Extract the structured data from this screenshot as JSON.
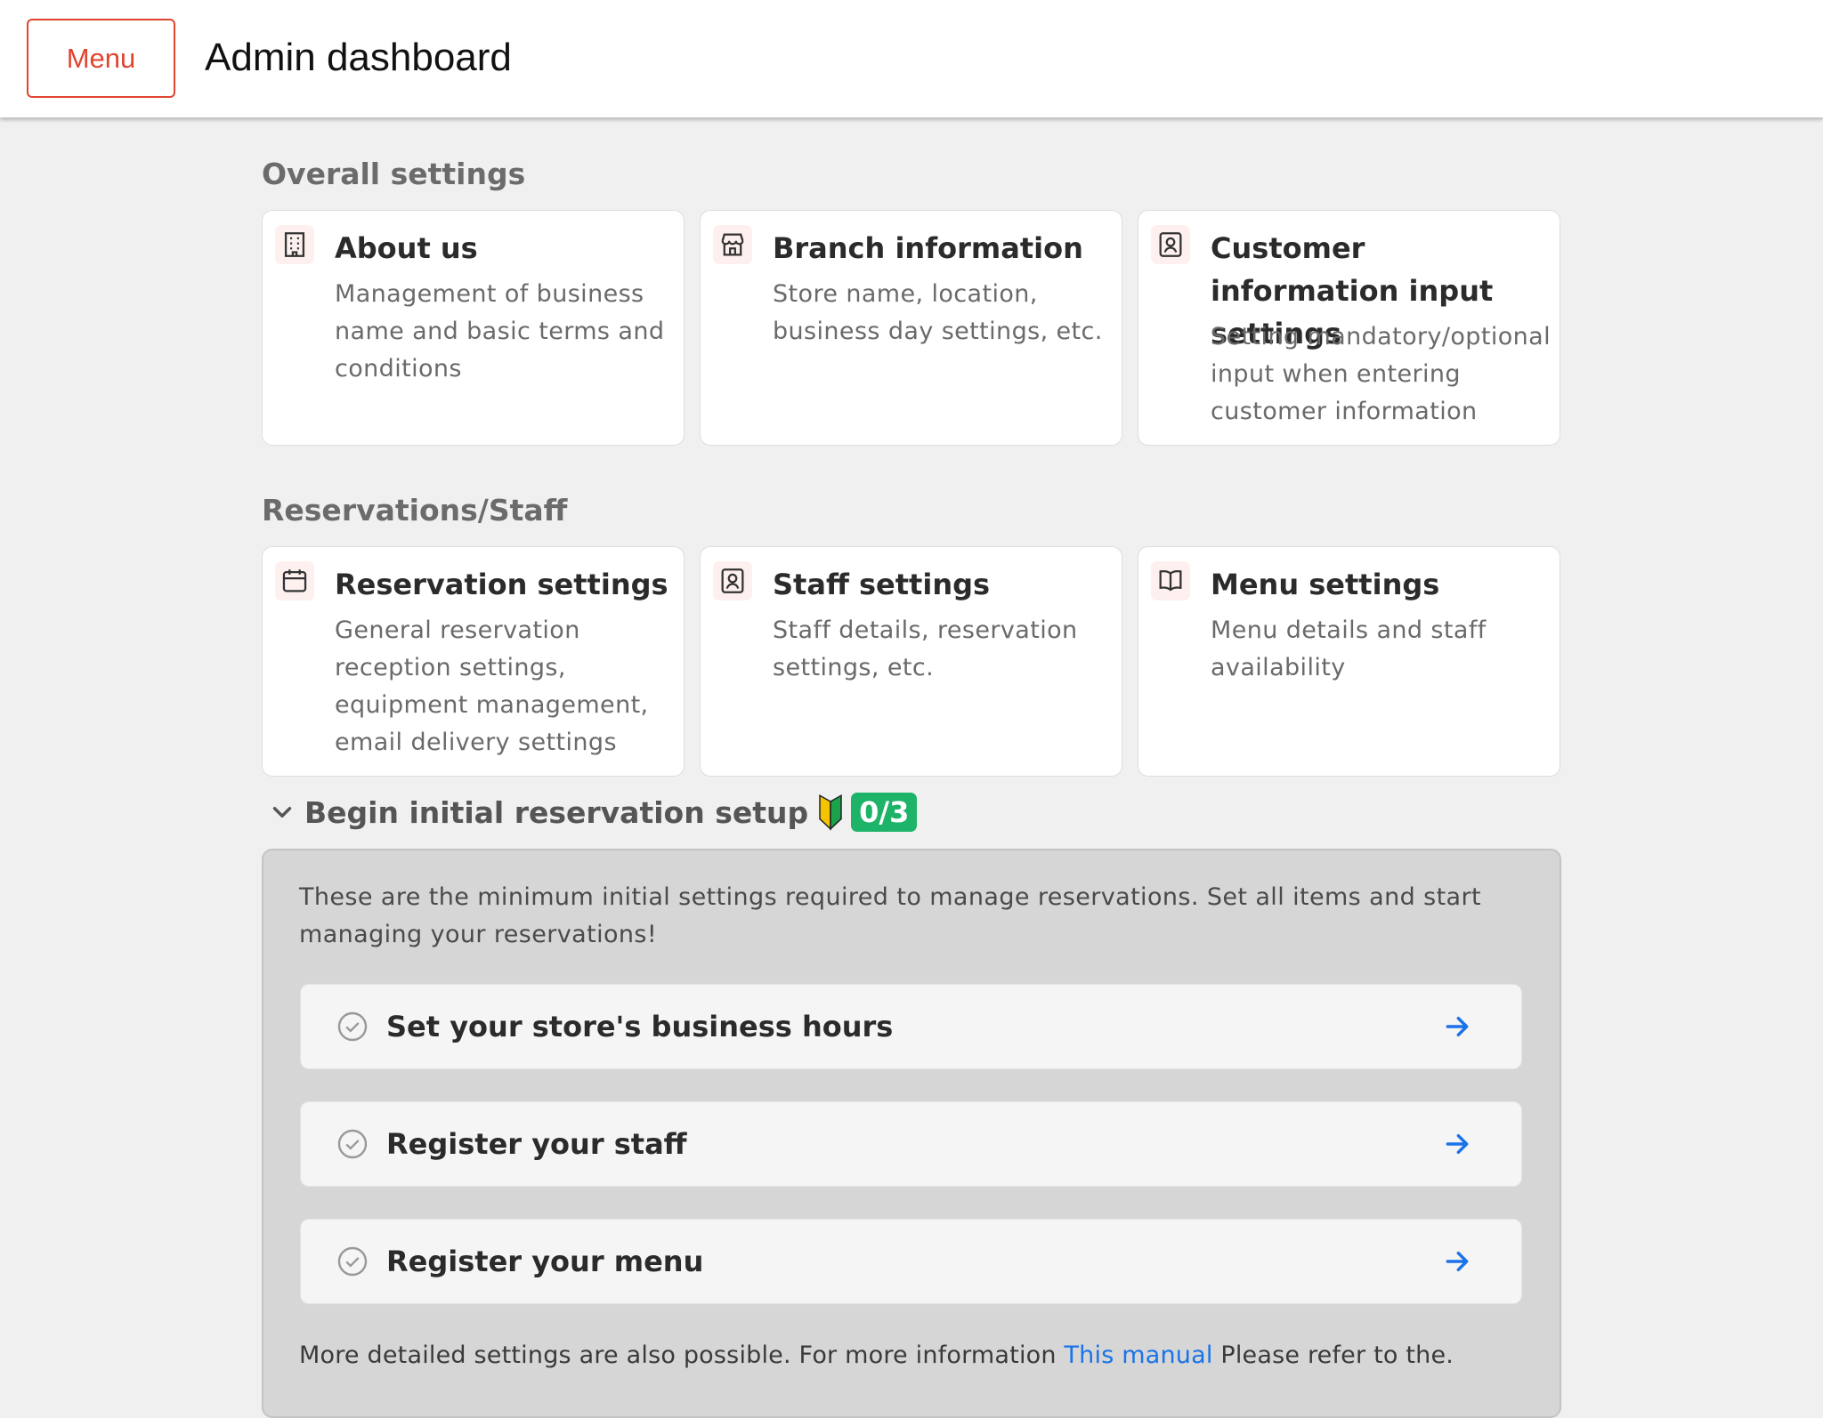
{
  "header": {
    "menu_label": "Menu",
    "title": "Admin dashboard"
  },
  "sections": {
    "overall": {
      "heading": "Overall settings",
      "cards": [
        {
          "title": "About us",
          "desc": "Management of business name and basic terms and conditions",
          "icon": "building-icon"
        },
        {
          "title": "Branch information",
          "desc": "Store name, location, business day settings, etc.",
          "icon": "store-icon"
        },
        {
          "title": "Customer information input settings",
          "desc": "Setting mandatory/optional input when entering customer information",
          "icon": "user-card-icon"
        }
      ]
    },
    "reservations": {
      "heading": "Reservations/Staff",
      "cards": [
        {
          "title": "Reservation settings",
          "desc": "General reservation reception settings, equipment management, email delivery settings",
          "icon": "calendar-icon"
        },
        {
          "title": "Staff settings",
          "desc": "Staff details, reservation settings, etc.",
          "icon": "user-card-icon"
        },
        {
          "title": "Menu settings",
          "desc": "Menu details and staff availability",
          "icon": "book-icon"
        }
      ]
    }
  },
  "setup": {
    "label": "Begin initial reservation setup",
    "progress": "0/3",
    "intro": "These are the minimum initial settings required to manage reservations. Set all items and start managing your reservations!",
    "tasks": [
      {
        "label": "Set your store's business hours",
        "done": false
      },
      {
        "label": "Register your staff",
        "done": false
      },
      {
        "label": "Register your menu",
        "done": false
      }
    ],
    "footer": {
      "before": "More detailed settings are also possible. For more information",
      "link": "This manual",
      "after": "Please refer to the."
    }
  },
  "colors": {
    "accent": "#e0452f",
    "badge": "#1db368",
    "link": "#1a73e8",
    "background": "#f0f0f0"
  }
}
